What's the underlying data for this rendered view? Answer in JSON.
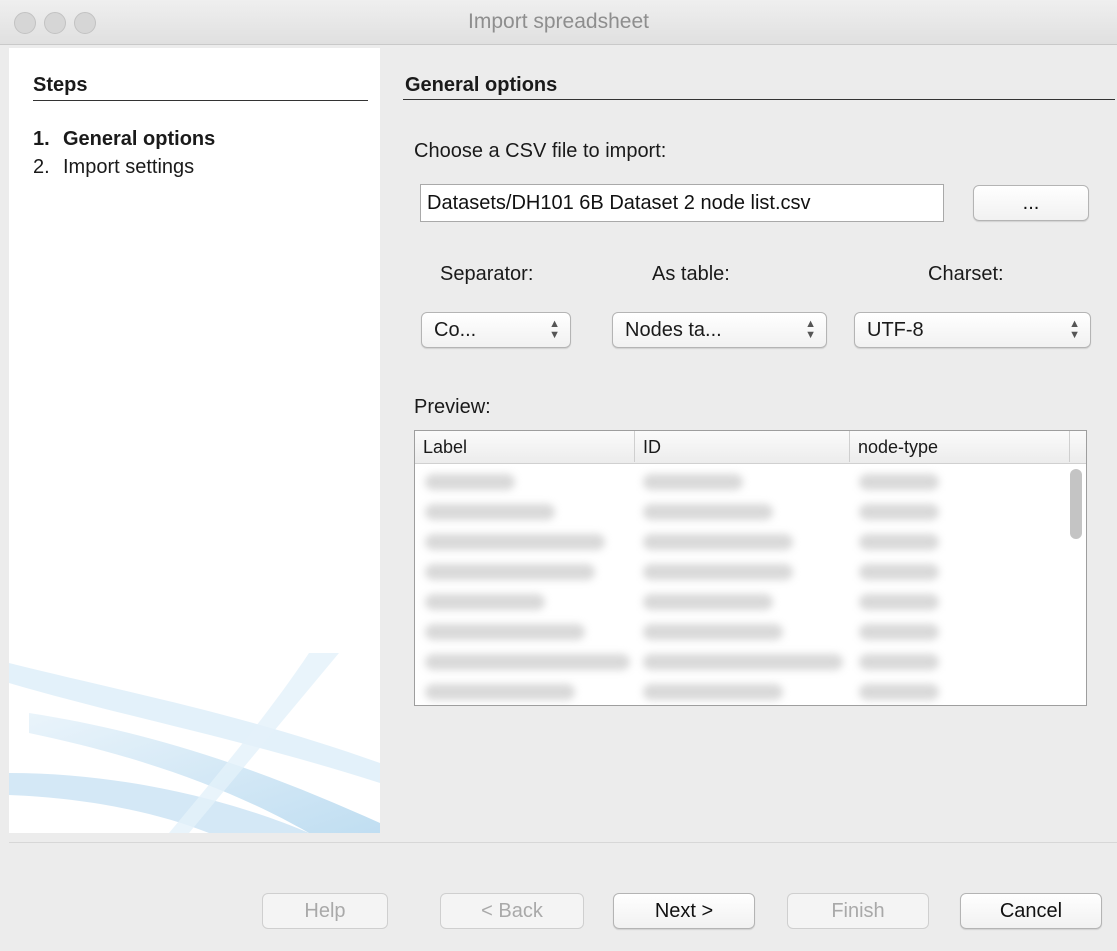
{
  "window": {
    "title": "Import spreadsheet"
  },
  "steps": {
    "title": "Steps",
    "items": [
      {
        "num": "1.",
        "label": "General options",
        "active": true
      },
      {
        "num": "2.",
        "label": "Import settings",
        "active": false
      }
    ]
  },
  "general": {
    "title": "General options",
    "file_label": "Choose a CSV file to import:",
    "file_value": "Datasets/DH101 6B Dataset 2 node list.csv",
    "browse_label": "...",
    "separator": {
      "label": "Separator:",
      "value": "Co..."
    },
    "as_table": {
      "label": "As table:",
      "value": "Nodes ta..."
    },
    "charset": {
      "label": "Charset:",
      "value": "UTF-8"
    }
  },
  "preview": {
    "label": "Preview:",
    "columns": [
      "Label",
      "ID",
      "node-type"
    ]
  },
  "buttons": {
    "help": "Help",
    "back": "< Back",
    "next": "Next >",
    "finish": "Finish",
    "cancel": "Cancel"
  }
}
